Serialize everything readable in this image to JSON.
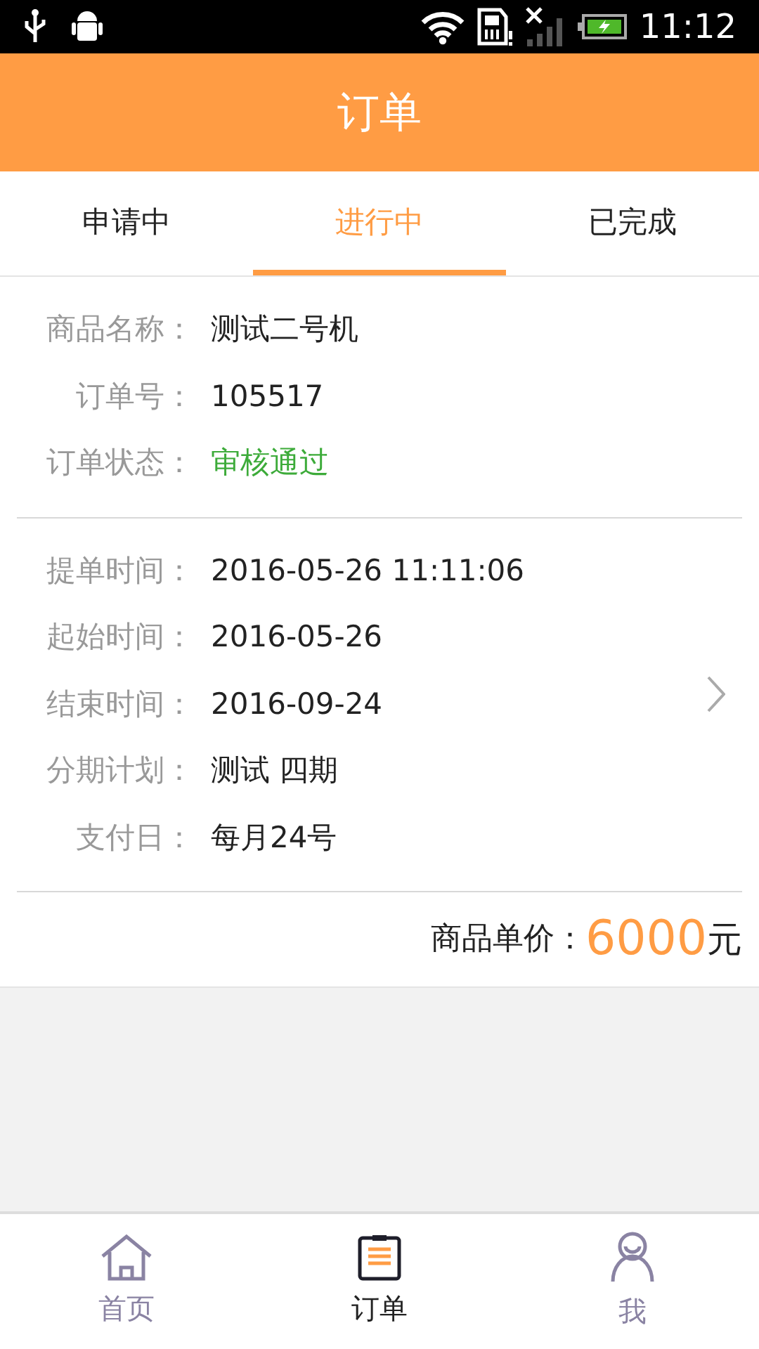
{
  "status_bar": {
    "time": "11:12"
  },
  "header": {
    "title": "订单"
  },
  "tabs": [
    {
      "label": "申请中",
      "selected": false
    },
    {
      "label": "进行中",
      "selected": true
    },
    {
      "label": "已完成",
      "selected": false
    }
  ],
  "order": {
    "sections": [
      [
        {
          "label": "商品名称：",
          "value": "测试二号机",
          "kind": "text"
        },
        {
          "label": "订单号：",
          "value": "105517",
          "kind": "text"
        },
        {
          "label": "订单状态：",
          "value": "审核通过",
          "kind": "status"
        }
      ],
      [
        {
          "label": "提单时间：",
          "value": "2016-05-26 11:11:06",
          "kind": "text"
        },
        {
          "label": "起始时间：",
          "value": "2016-05-26",
          "kind": "text"
        },
        {
          "label": "结束时间：",
          "value": "2016-09-24",
          "kind": "text"
        },
        {
          "label": "分期计划：",
          "value": "测试 四期",
          "kind": "text"
        },
        {
          "label": "支付日：",
          "value": "每月24号",
          "kind": "text"
        }
      ]
    ],
    "price": {
      "label": "商品单价：",
      "amount": "6000",
      "unit": "元"
    }
  },
  "nav": [
    {
      "label": "首页",
      "kind": "home",
      "selected": false
    },
    {
      "label": "订单",
      "kind": "orders",
      "selected": true
    },
    {
      "label": "我",
      "kind": "me",
      "selected": false
    }
  ]
}
